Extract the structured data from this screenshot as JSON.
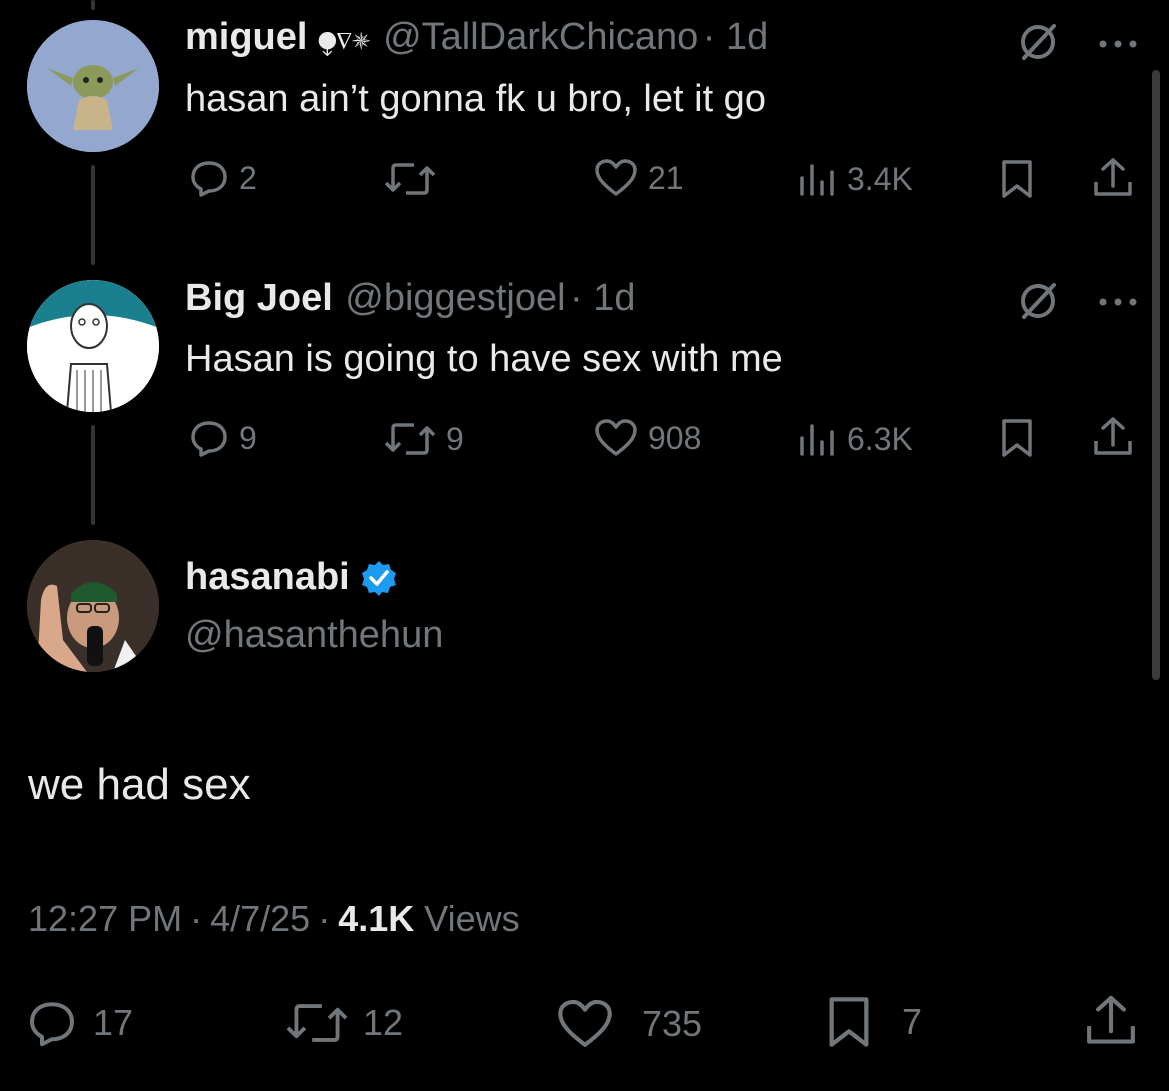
{
  "tweets": [
    {
      "name": "miguel",
      "badges": "⧭∇✵",
      "handle": "@TallDarkChicano",
      "time": "· 1d",
      "text": "hasan ain’t gonna fk u bro, let it go",
      "replies": "2",
      "reposts": "",
      "likes": "21",
      "views": "3.4K"
    },
    {
      "name": "Big Joel",
      "handle": "@biggestjoel",
      "time": "· 1d",
      "text": "Hasan is going to have sex with me",
      "replies": "9",
      "reposts": "9",
      "likes": "908",
      "views": "6.3K"
    }
  ],
  "main": {
    "name": "hasanabi",
    "handle": "@hasanthehun",
    "text": "we had sex",
    "time": "12:27 PM",
    "date": "4/7/25",
    "sep": "·",
    "views_count": "4.1K",
    "views_label": "Views",
    "replies": "17",
    "reposts": "12",
    "likes": "735",
    "bookmarks": "7"
  },
  "colors": {
    "accent": "#1d9bf0",
    "muted": "#71767b",
    "text": "#e7e9ea"
  }
}
